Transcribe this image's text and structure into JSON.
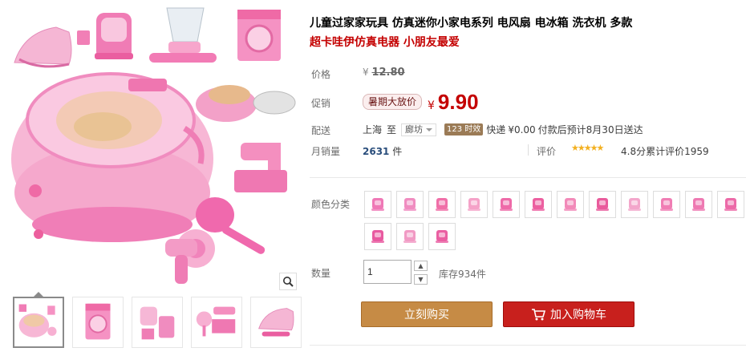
{
  "product": {
    "title": "儿童过家家玩具 仿真迷你小家电系列 电风扇 电冰箱 洗衣机 多款",
    "subtitle": "超卡哇伊仿真电器 小朋友最爱"
  },
  "price": {
    "label": "价格",
    "currency": "¥",
    "original": "12.80"
  },
  "promo": {
    "label": "促销",
    "tag": "暑期大放价",
    "currency": "¥",
    "price": "9.90"
  },
  "shipping": {
    "label": "配送",
    "from": "上海",
    "to_word": "至",
    "destination": "廊坊",
    "time_badge": "123 时效",
    "method": "快递",
    "fee": "¥0.00",
    "note": "付款后预计8月30日送达"
  },
  "sales": {
    "label": "月销量",
    "count": "2631",
    "unit": "件"
  },
  "reviews": {
    "label": "评价",
    "stars": "★★★★★",
    "score_text": "4.8分累计评价1959"
  },
  "colors": {
    "label": "颜色分类",
    "options": [
      {
        "name": "scale-icon",
        "color": "#ef78b6"
      },
      {
        "name": "mixer-icon",
        "color": "#f08cc0"
      },
      {
        "name": "microwave-icon",
        "color": "#f06fa8"
      },
      {
        "name": "toaster-icon",
        "color": "#f5a2c8"
      },
      {
        "name": "coffee-machine-icon",
        "color": "#ee6aa8"
      },
      {
        "name": "sewing-machine-icon",
        "color": "#ec5fa0"
      },
      {
        "name": "hair-dryer-icon",
        "color": "#f28ab9"
      },
      {
        "name": "kettle-icon",
        "color": "#e95b9c"
      },
      {
        "name": "iron-icon",
        "color": "#f3a6cb"
      },
      {
        "name": "washer-icon",
        "color": "#f07db4"
      },
      {
        "name": "fan-icon",
        "color": "#ee79b2"
      },
      {
        "name": "desk-fan-icon",
        "color": "#ec6aa8"
      },
      {
        "name": "hair-dryer-icon",
        "color": "#e85aa0"
      },
      {
        "name": "blender-icon",
        "color": "#f19ac4"
      },
      {
        "name": "vacuum-icon",
        "color": "#ea5fa2"
      }
    ]
  },
  "quantity": {
    "label": "数量",
    "value": "1",
    "stock": "库存934件"
  },
  "actions": {
    "buy": "立刻购买",
    "cart": "加入购物车"
  }
}
